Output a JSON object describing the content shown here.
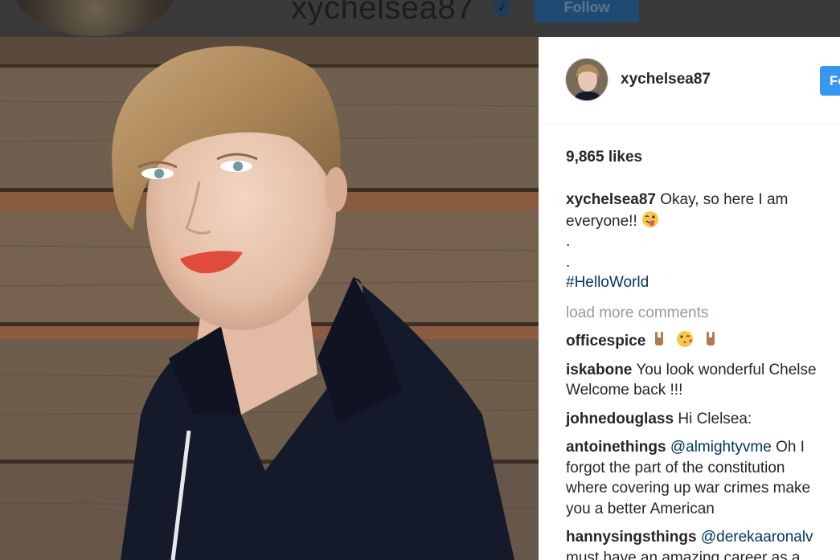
{
  "background_header": {
    "username": "xychelsea87",
    "follow_label": "Follow"
  },
  "post": {
    "username": "xychelsea87",
    "follow_label": "Fo",
    "likes": "9,865 likes",
    "caption": {
      "username": "xychelsea87",
      "text_line1": "Okay, so here I am",
      "text_line2": "everyone!!",
      "dot1": ".",
      "dot2": ".",
      "hashtag": "#HelloWorld"
    },
    "load_more": "load more comments",
    "comments": [
      {
        "username": "officespice",
        "emojis": [
          "rock-hand-emoji",
          "kiss-emoji",
          "rock-hand-emoji"
        ]
      },
      {
        "username": "iskabone",
        "text1": "You look wonderful Chelse",
        "text2": "Welcome back !!!"
      },
      {
        "username": "johnedouglass",
        "text1": "Hi Clelsea:"
      },
      {
        "username": "antoinethings",
        "mention": "@almightyvme",
        "text1": "Oh I",
        "text2": "forgot the part of the constitution",
        "text3": "where covering up war crimes make",
        "text4": "you a better American"
      },
      {
        "username": "hannysingsthings",
        "mention": "@derekaaronalv",
        "text2": "must have an amazing career as a"
      }
    ]
  },
  "colors": {
    "follow_blue": "#3897f0",
    "hashtag_blue": "#003569",
    "muted_gray": "#999999",
    "text": "#262626"
  }
}
